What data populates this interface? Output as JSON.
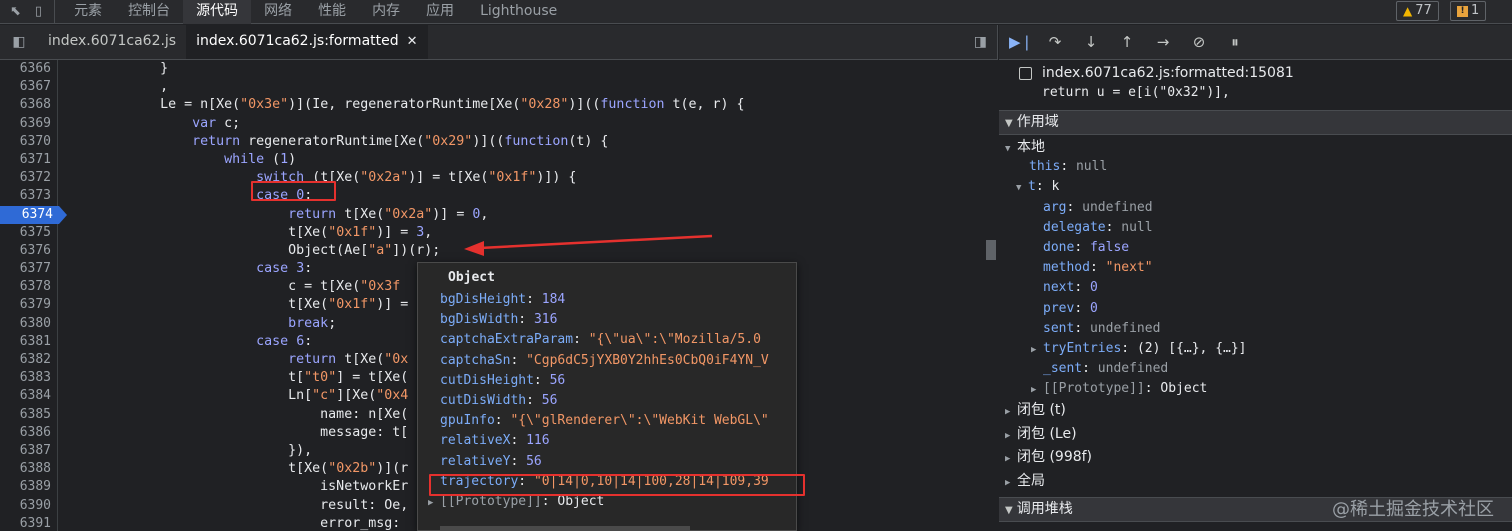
{
  "topbar": {
    "tabs": [
      "元素",
      "控制台",
      "源代码",
      "网络",
      "性能",
      "内存",
      "应用",
      "Lighthouse"
    ],
    "active_tab": "源代码",
    "warnings_count": "77",
    "errors_count": "1"
  },
  "editor": {
    "file_tabs": [
      "index.6071ca62.js",
      "index.6071ca62.js:formatted"
    ],
    "active_file_tab": "index.6071ca62.js:formatted",
    "current_line": "6374",
    "line_numbers": [
      "6366",
      "6367",
      "6368",
      "6369",
      "6370",
      "6371",
      "6372",
      "6373",
      "6374",
      "6375",
      "6376",
      "6377",
      "6378",
      "6379",
      "6380",
      "6381",
      "6382",
      "6383",
      "6384",
      "6385",
      "6386",
      "6387",
      "6388",
      "6389",
      "6390",
      "6391"
    ],
    "code_lines": [
      "            }",
      "            ,",
      "            Le = n[Xe(\"0x3e\")](Ie, regeneratorRuntime[Xe(\"0x28\")]((function t(e, r) {",
      "                var c;",
      "                return regeneratorRuntime[Xe(\"0x29\")]((function(t) {",
      "                    while (1)",
      "                        switch (t[Xe(\"0x2a\")] = t[Xe(\"0x1f\")]) {",
      "                        case 0:",
      "                            return t[Xe(\"0x2a\")] = 0,",
      "                            t[Xe(\"0x1f\")] = 3,",
      "                            Object(Ae[\"a\"])(r);",
      "                        case 3:",
      "                            c = t[Xe(\"0x3f",
      "                            t[Xe(\"0x1f\")] =",
      "                            break;",
      "                        case 6:",
      "                            return t[Xe(\"0x",
      "                            t[\"t0\"] = t[Xe(",
      "                            Ln[\"c\"][Xe(\"0x4",
      "                                name: n[Xe(",
      "                                message: t[",
      "                            }),",
      "                            t[Xe(\"0x2b\")](r",
      "                                isNetworkEr",
      "                                result: Oe,",
      "                                error_msg:"
    ]
  },
  "popover": {
    "title": "Object",
    "props": [
      {
        "key": "bgDisHeight",
        "value": "184",
        "kind": "num"
      },
      {
        "key": "bgDisWidth",
        "value": "316",
        "kind": "num"
      },
      {
        "key": "captchaExtraParam",
        "value": "\"{\\\"ua\\\":\\\"Mozilla/5.0",
        "kind": "str"
      },
      {
        "key": "captchaSn",
        "value": "\"Cgp6dC5jYXB0Y2hhEs0CbQ0iF4YN_V",
        "kind": "str"
      },
      {
        "key": "cutDisHeight",
        "value": "56",
        "kind": "num"
      },
      {
        "key": "cutDisWidth",
        "value": "56",
        "kind": "num"
      },
      {
        "key": "gpuInfo",
        "value": "\"{\\\"glRenderer\\\":\\\"WebKit WebGL\\\"",
        "kind": "str"
      },
      {
        "key": "relativeX",
        "value": "116",
        "kind": "num"
      },
      {
        "key": "relativeY",
        "value": "56",
        "kind": "num"
      },
      {
        "key": "trajectory",
        "value": "\"0|14|0,10|14|100,28|14|109,39",
        "kind": "str"
      },
      {
        "key": "[[Prototype]]",
        "value": "Object",
        "kind": "obj"
      }
    ]
  },
  "debugger": {
    "breakpoint_file": "index.6071ca62.js:formatted:15081",
    "breakpoint_code": "return u = e[i(\"0x32\")],",
    "scope_header": "作用域",
    "scope_local": "本地",
    "this_key": "this",
    "this_val": "null",
    "t_key": "t",
    "t_val": "k",
    "t_props": [
      {
        "key": "arg",
        "value": "undefined",
        "kind": "null"
      },
      {
        "key": "delegate",
        "value": "null",
        "kind": "null"
      },
      {
        "key": "done",
        "value": "false",
        "kind": "bool"
      },
      {
        "key": "method",
        "value": "\"next\"",
        "kind": "str"
      },
      {
        "key": "next",
        "value": "0",
        "kind": "num"
      },
      {
        "key": "prev",
        "value": "0",
        "kind": "num"
      },
      {
        "key": "sent",
        "value": "undefined",
        "kind": "null"
      }
    ],
    "try_entries_key": "tryEntries",
    "try_entries_val": "(2) [{…}, {…}]",
    "sent2_key": "_sent",
    "sent2_val": "undefined",
    "proto_key": "[[Prototype]]",
    "proto_val": "Object",
    "closures": [
      "闭包 (t)",
      "闭包 (Le)",
      "闭包 (998f)"
    ],
    "global": "全局",
    "callstack_header": "调用堆栈",
    "watermark": "@稀土掘金技术社区"
  },
  "colors": {
    "accent": "#2f6ad6",
    "annotation_red": "#e5312e",
    "warning": "#f2b600"
  }
}
